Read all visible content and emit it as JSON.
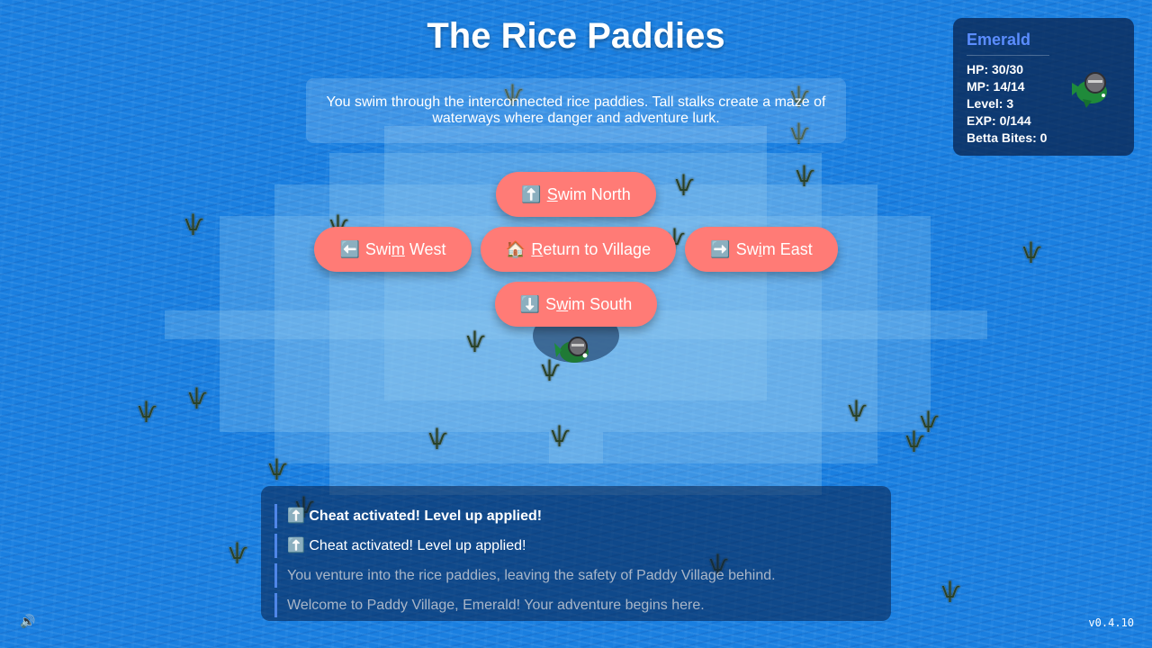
{
  "location": {
    "title": "The Rice Paddies",
    "description": "You swim through the interconnected rice paddies. Tall stalks create a maze of waterways where danger and adventure lurk."
  },
  "player": {
    "name": "Emerald",
    "hp": "HP: 30/30",
    "mp": "MP: 14/14",
    "level": "Level: 3",
    "exp": "EXP: 0/144",
    "betta_bites": "Betta Bites: 0"
  },
  "actions": {
    "north": {
      "icon": "⬆️",
      "pre": "",
      "key": "S",
      "post": "wim North"
    },
    "west": {
      "icon": "⬅️",
      "pre": "Swi",
      "key": "m",
      "post": " West"
    },
    "village": {
      "icon": "🏠",
      "pre": "",
      "key": "R",
      "post": "eturn to Village"
    },
    "east": {
      "icon": "➡️",
      "pre": "Sw",
      "key": "i",
      "post": "m East"
    },
    "south": {
      "icon": "⬇️",
      "pre": "S",
      "key": "w",
      "post": "im South"
    }
  },
  "log": [
    {
      "icon": "⬆️",
      "text": "Cheat activated! Level up applied!"
    },
    {
      "icon": "⬆️",
      "text": "Cheat activated! Level up applied!"
    },
    {
      "icon": "",
      "text": "You venture into the rice paddies, leaving the safety of Paddy Village behind."
    },
    {
      "icon": "",
      "text": "Welcome to Paddy Village, Emerald! Your adventure begins here."
    }
  ],
  "icons": {
    "sound": "🔊",
    "reed": "reed-icon",
    "portrait": "fish-knight-icon"
  },
  "colors": {
    "water": "#1a7fe0",
    "button": "#ff7b76",
    "player_name": "#5b8dff",
    "log_border": "#4f86e8"
  },
  "version": "v0.4.10"
}
